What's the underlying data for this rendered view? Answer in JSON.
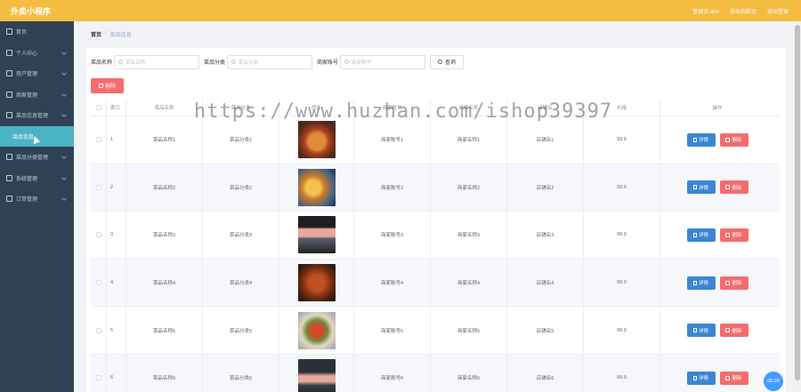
{
  "header": {
    "title": "外卖小程序",
    "user": "管理员 abo",
    "front": "退出到前台",
    "logout": "退出登录"
  },
  "sidebar": {
    "items": [
      {
        "label": "首页",
        "icon": "home-icon"
      },
      {
        "label": "个人中心",
        "icon": "user-icon"
      },
      {
        "label": "用户管理",
        "icon": "users-icon"
      },
      {
        "label": "商家管理",
        "icon": "store-icon"
      },
      {
        "label": "菜品信息管理",
        "icon": "dish-icon"
      },
      {
        "label": "菜品信息",
        "icon": "",
        "sub": true,
        "active": true
      },
      {
        "label": "菜品分类管理",
        "icon": "category-icon"
      },
      {
        "label": "系统管理",
        "icon": "system-icon"
      },
      {
        "label": "订单管理",
        "icon": "order-icon"
      }
    ]
  },
  "breadcrumb": {
    "home": "首页",
    "sep": "/",
    "current": "菜品信息"
  },
  "search": {
    "name_label": "菜品名称",
    "name_placeholder": "菜品名称",
    "category_label": "菜品分类",
    "category_placeholder": "菜品分类",
    "merchant_label": "商家账号",
    "merchant_placeholder": "商家账号",
    "query_label": "查询"
  },
  "toolbar": {
    "delete_label": "删除"
  },
  "table": {
    "headers": [
      "索引",
      "菜品名称",
      "菜品分类",
      "图片",
      "商家账号",
      "商家名称",
      "店铺名",
      "价格",
      "操作"
    ],
    "rows": [
      {
        "idx": "1",
        "name": "菜品名称1",
        "category": "菜品分类1",
        "merchant_id": "商家账号1",
        "merchant_name": "商家名称1",
        "shop": "店铺名1",
        "price": "99.9"
      },
      {
        "idx": "2",
        "name": "菜品名称2",
        "category": "菜品分类2",
        "merchant_id": "商家账号2",
        "merchant_name": "商家名称2",
        "shop": "店铺名2",
        "price": "99.9"
      },
      {
        "idx": "3",
        "name": "菜品名称3",
        "category": "菜品分类3",
        "merchant_id": "商家账号3",
        "merchant_name": "商家名称3",
        "shop": "店铺名3",
        "price": "99.9"
      },
      {
        "idx": "4",
        "name": "菜品名称4",
        "category": "菜品分类4",
        "merchant_id": "商家账号4",
        "merchant_name": "商家名称4",
        "shop": "店铺名4",
        "price": "99.9"
      },
      {
        "idx": "5",
        "name": "菜品名称5",
        "category": "菜品分类5",
        "merchant_id": "商家账号5",
        "merchant_name": "商家名称5",
        "shop": "店铺名5",
        "price": "99.9"
      },
      {
        "idx": "6",
        "name": "菜品名称6",
        "category": "菜品分类6",
        "merchant_id": "商家账号6",
        "merchant_name": "商家名称6",
        "shop": "店铺名6",
        "price": "99.9"
      }
    ],
    "detail_label": "详情",
    "delete_label": "删除"
  },
  "watermark": "https://www.huzhan.com/ishop39397",
  "timer": "00:26",
  "colors": {
    "header": "#f5bc42",
    "sidebar": "#304156",
    "active": "#4bb4c4",
    "danger": "#f56c6c",
    "primary": "#3a86d4"
  }
}
